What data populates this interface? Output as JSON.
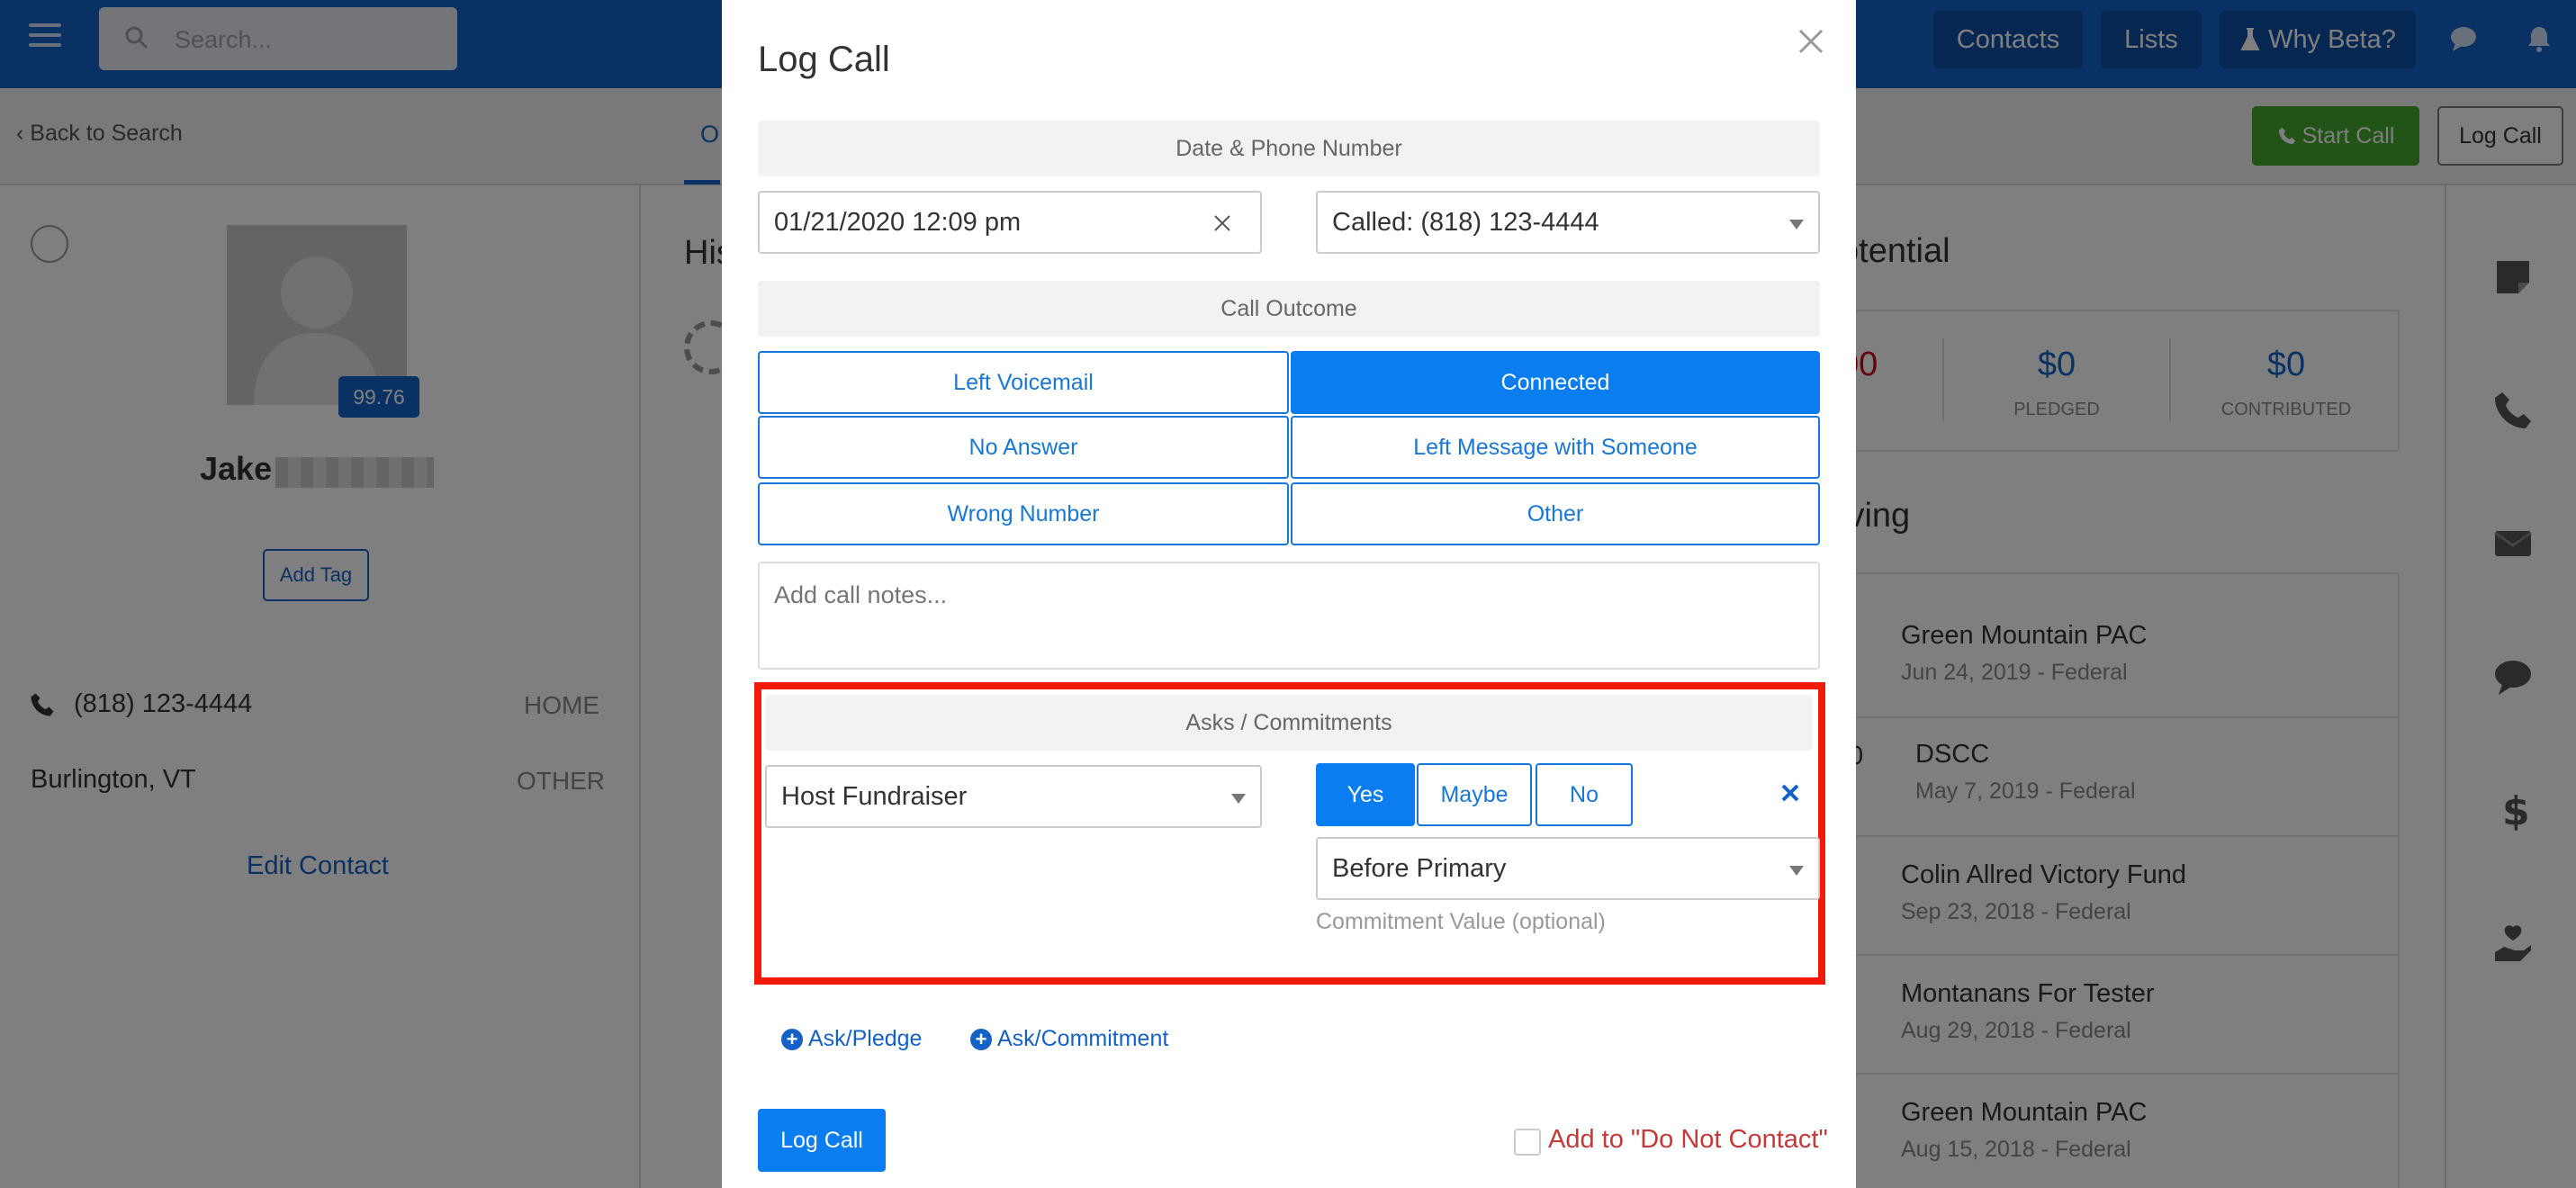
{
  "app": {
    "search_placeholder": "Search...",
    "nav": {
      "contacts": "Contacts",
      "lists": "Lists",
      "why_beta": "Why Beta?"
    },
    "back_to_search": "Back to Search",
    "tab_stub": "O",
    "start_call": "Start Call",
    "log_call_top": "Log Call",
    "accent_color": "#1462c8",
    "icons": [
      "menu-icon",
      "search-icon",
      "flask-icon",
      "chat-icon",
      "bell-icon",
      "phone-icon",
      "note-icon",
      "mail-icon",
      "dollar-icon",
      "donate-icon"
    ]
  },
  "contact": {
    "score": "99.76",
    "first_name": "Jake",
    "add_tag": "Add Tag",
    "phone": "(818) 123-4444",
    "phone_type": "HOME",
    "city": "Burlington, VT",
    "city_type": "OTHER",
    "edit_contact": "Edit Contact"
  },
  "middle": {
    "history_stub": "His"
  },
  "potential": {
    "title_stub": "otential",
    "stat1_stub": "00",
    "stat1_label_stub": "",
    "pledged_value": "$0",
    "pledged_label": "PLEDGED",
    "contributed_value": "$0",
    "contributed_label": "CONTRIBUTED"
  },
  "giving": {
    "title_stub": "iving",
    "items": [
      {
        "name": "Green Mountain PAC",
        "date": "Jun 24, 2019 - Federal"
      },
      {
        "name": "DSCC",
        "date": "May 7, 2019 - Federal",
        "amount_stub": "0"
      },
      {
        "name": "Colin Allred Victory Fund",
        "date": "Sep 23, 2018 - Federal"
      },
      {
        "name": "Montanans For Tester",
        "date": "Aug 29, 2018 - Federal"
      },
      {
        "name": "Green Mountain PAC",
        "date": "Aug 15, 2018 - Federal"
      }
    ]
  },
  "modal": {
    "title": "Log Call",
    "date_phone_header": "Date & Phone Number",
    "datetime_value": "01/21/2020 12:09 pm",
    "called_value": "Called: (818) 123-4444",
    "call_outcome_header": "Call Outcome",
    "outcomes": {
      "left_voicemail": "Left Voicemail",
      "connected": "Connected",
      "no_answer": "No Answer",
      "left_message": "Left Message with Someone",
      "wrong_number": "Wrong Number",
      "other": "Other"
    },
    "selected_outcome": "Connected",
    "notes_placeholder": "Add call notes...",
    "asks_header": "Asks / Commitments",
    "ask_type": "Host Fundraiser",
    "yes": "Yes",
    "maybe": "Maybe",
    "no": "No",
    "selected_answer": "Yes",
    "timing": "Before Primary",
    "commitment_hint": "Commitment Value (optional)",
    "add_ask_pledge": "Ask/Pledge",
    "add_ask_commitment": "Ask/Commitment",
    "log_call_button": "Log Call",
    "do_not_contact_label": "Add to \"Do Not Contact\"",
    "do_not_contact_checked": false,
    "highlight_color": "#f41a0b"
  }
}
